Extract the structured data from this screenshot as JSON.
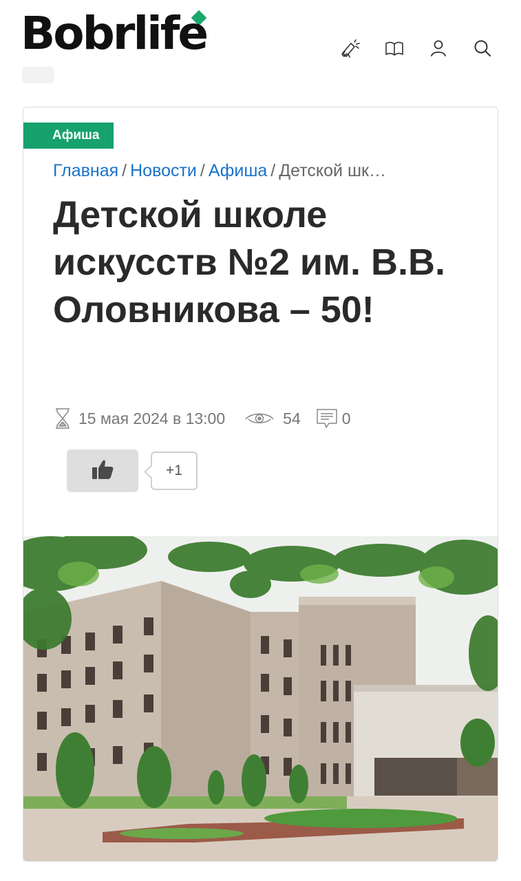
{
  "header": {
    "logo_text": "Bobrlife",
    "icons": [
      "announcement-icon",
      "book-icon",
      "user-icon",
      "search-icon"
    ]
  },
  "article": {
    "category_tag": "Афиша",
    "breadcrumb": {
      "home": "Главная",
      "news": "Новости",
      "afisha": "Афиша",
      "current": "Детской шк…",
      "separator": "/"
    },
    "title": "Детской школе искусств №2 им. В.В. Оловникова – 50!",
    "date": "15 мая 2024 в 13:00",
    "views": "54",
    "comments": "0",
    "likes": "+1"
  },
  "colors": {
    "accent_green": "#17a16d",
    "link_blue": "#1a73c8",
    "title_text": "#2a2a2a"
  }
}
